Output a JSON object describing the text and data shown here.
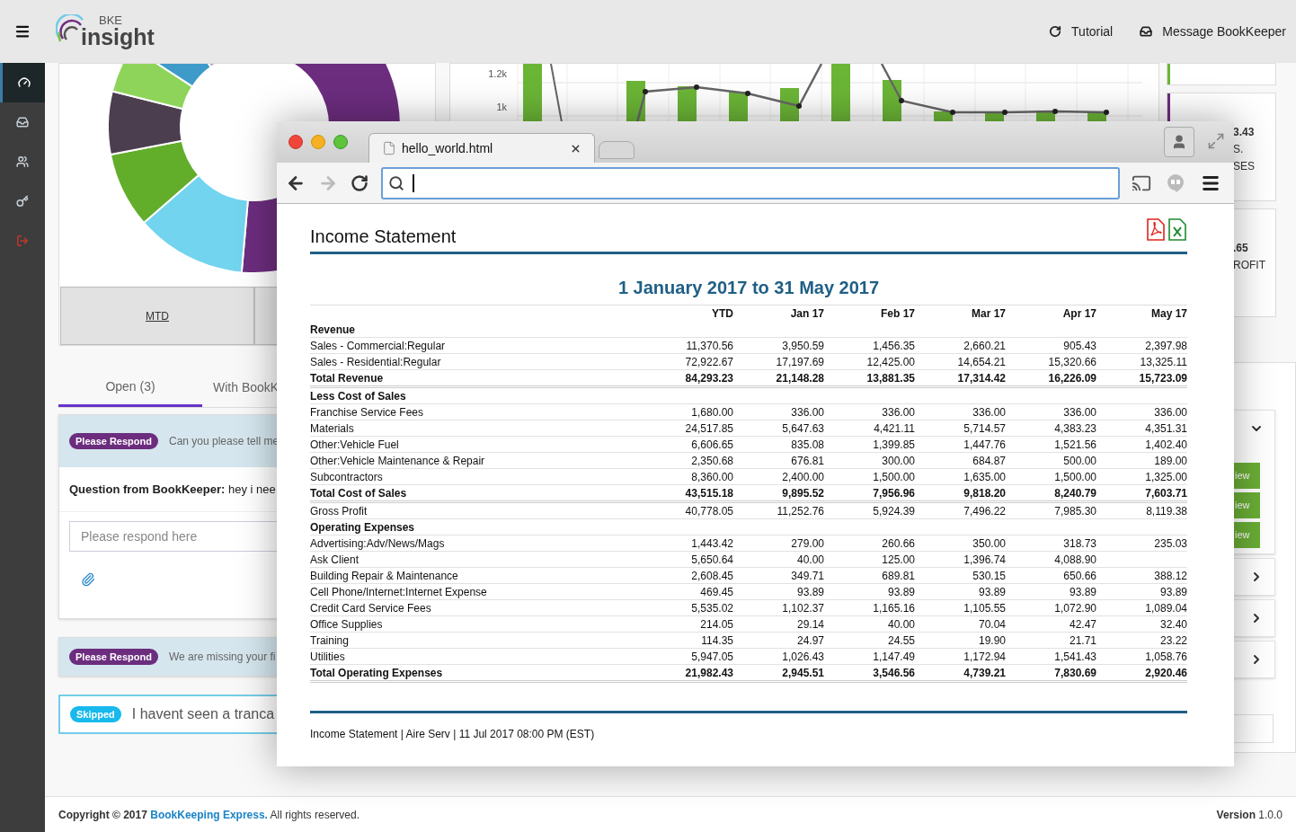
{
  "header": {
    "logo_small": "BKE",
    "logo_main": "insight",
    "actions": [
      {
        "label": "Tutorial",
        "kind": "refresh"
      },
      {
        "label": "Message BookKeeper",
        "kind": "inbox"
      }
    ]
  },
  "sidebar": {
    "items": [
      {
        "kind": "nav",
        "selected": true
      },
      {
        "kind": "nav",
        "selected": false
      },
      {
        "kind": "nav",
        "selected": false
      },
      {
        "kind": "nav",
        "selected": false
      },
      {
        "kind": "logout",
        "selected": false
      }
    ]
  },
  "donut_card": {
    "period_button": "MTD"
  },
  "tabs": [
    {
      "label": "Open (3)",
      "selected": true
    },
    {
      "label": "With BookK",
      "selected": false
    }
  ],
  "messages": [
    {
      "kind": "respond",
      "status": "Please Respond",
      "preview": "Can you please tell me",
      "expanded": true,
      "question": "**Question from BookKeeper:** hey i nee",
      "reply_placeholder": "Please respond here"
    },
    {
      "kind": "respond",
      "status": "Please Respond",
      "preview": "We are missing your fi",
      "expanded": false
    },
    {
      "kind": "skipped",
      "status": "Skipped",
      "preview": "I havent seen a tranca",
      "expanded": false
    }
  ],
  "chart": {
    "axis_labels": [
      "1.2k",
      "1k"
    ]
  },
  "summary_cards": [
    {
      "color": "#6bb536"
    },
    {
      "color": "#6c2d7e",
      "value": "3.43",
      "lines": [
        "S.",
        "SES"
      ]
    },
    {
      "value": ".65",
      "lines": [
        "ROFIT"
      ]
    }
  ],
  "accordion": [
    {
      "expanded": true,
      "buttons": [
        "iew",
        "iew",
        "iew"
      ]
    },
    {
      "expanded": false
    },
    {
      "expanded": false
    },
    {
      "expanded": false
    }
  ],
  "browser": {
    "tab_title": "hello_world.html",
    "report": {
      "title": "Income Statement",
      "period": "1 January 2017 to 31 May 2017",
      "columns": [
        "YTD",
        "Jan 17",
        "Feb 17",
        "Mar 17",
        "Apr 17",
        "May 17"
      ],
      "rows": [
        {
          "kind": "heading",
          "label": "Revenue"
        },
        {
          "kind": "line",
          "label": "Sales - Commercial:Regular",
          "values": [
            "11,370.56",
            "3,950.59",
            "1,456.35",
            "2,660.21",
            "905.43",
            "2,397.98"
          ]
        },
        {
          "kind": "line",
          "label": "Sales - Residential:Regular",
          "values": [
            "72,922.67",
            "17,197.69",
            "12,425.00",
            "14,654.21",
            "15,320.66",
            "13,325.11"
          ]
        },
        {
          "kind": "total",
          "label": "Total Revenue",
          "values": [
            "84,293.23",
            "21,148.28",
            "13,881.35",
            "17,314.42",
            "16,226.09",
            "15,723.09"
          ]
        },
        {
          "kind": "heading",
          "label": "Less Cost of Sales"
        },
        {
          "kind": "line",
          "label": "Franchise Service Fees",
          "values": [
            "1,680.00",
            "336.00",
            "336.00",
            "336.00",
            "336.00",
            "336.00"
          ]
        },
        {
          "kind": "line",
          "label": "Materials",
          "values": [
            "24,517.85",
            "5,647.63",
            "4,421.11",
            "5,714.57",
            "4,383.23",
            "4,351.31"
          ]
        },
        {
          "kind": "line",
          "label": "Other:Vehicle Fuel",
          "values": [
            "6,606.65",
            "835.08",
            "1,399.85",
            "1,447.76",
            "1,521.56",
            "1,402.40"
          ]
        },
        {
          "kind": "line",
          "label": "Other:Vehicle Maintenance & Repair",
          "values": [
            "2,350.68",
            "676.81",
            "300.00",
            "684.87",
            "500.00",
            "189.00"
          ]
        },
        {
          "kind": "line",
          "label": "Subcontractors",
          "values": [
            "8,360.00",
            "2,400.00",
            "1,500.00",
            "1,635.00",
            "1,500.00",
            "1,325.00"
          ]
        },
        {
          "kind": "total",
          "label": "Total Cost of Sales",
          "values": [
            "43,515.18",
            "9,895.52",
            "7,956.96",
            "9,818.20",
            "8,240.79",
            "7,603.71"
          ]
        },
        {
          "kind": "line",
          "label": "Gross Profit",
          "values": [
            "40,778.05",
            "11,252.76",
            "5,924.39",
            "7,496.22",
            "7,985.30",
            "8,119.38"
          ]
        },
        {
          "kind": "heading",
          "label": "Operating Expenses"
        },
        {
          "kind": "line",
          "label": "Advertising:Adv/News/Mags",
          "values": [
            "1,443.42",
            "279.00",
            "260.66",
            "350.00",
            "318.73",
            "235.03"
          ]
        },
        {
          "kind": "line",
          "label": "Ask Client",
          "values": [
            "5,650.64",
            "40.00",
            "125.00",
            "1,396.74",
            "4,088.90"
          ]
        },
        {
          "kind": "line",
          "label": "Building Repair & Maintenance",
          "values": [
            "2,608.45",
            "349.71",
            "689.81",
            "530.15",
            "650.66",
            "388.12"
          ]
        },
        {
          "kind": "line",
          "label": "Cell Phone/Internet:Internet Expense",
          "values": [
            "469.45",
            "93.89",
            "93.89",
            "93.89",
            "93.89",
            "93.89"
          ]
        },
        {
          "kind": "line",
          "label": "Credit Card Service Fees",
          "values": [
            "5,535.02",
            "1,102.37",
            "1,165.16",
            "1,105.55",
            "1,072.90",
            "1,089.04"
          ]
        },
        {
          "kind": "line",
          "label": "Office Supplies",
          "values": [
            "214.05",
            "29.14",
            "40.00",
            "70.04",
            "42.47",
            "32.40"
          ]
        },
        {
          "kind": "line",
          "label": "Training",
          "values": [
            "114.35",
            "24.97",
            "24.55",
            "19.90",
            "21.71",
            "23.22"
          ]
        },
        {
          "kind": "line",
          "label": "Utilities",
          "values": [
            "5,947.05",
            "1,026.43",
            "1,147.49",
            "1,172.94",
            "1,541.43",
            "1,058.76"
          ]
        },
        {
          "kind": "total",
          "label": "Total Operating Expenses",
          "values": [
            "21,982.43",
            "2,945.51",
            "3,546.56",
            "4,739.21",
            "7,830.69",
            "2,920.46"
          ]
        }
      ],
      "footer": "Income Statement | Aire Serv | 11 Jul 2017 08:00 PM (EST)"
    }
  },
  "footer": {
    "copyright_before": "**Copyright © 2017**",
    "link": "BookKeeping Express.",
    "copyright_after": "All rights reserved.",
    "version": "**Version** 1.0.0"
  }
}
